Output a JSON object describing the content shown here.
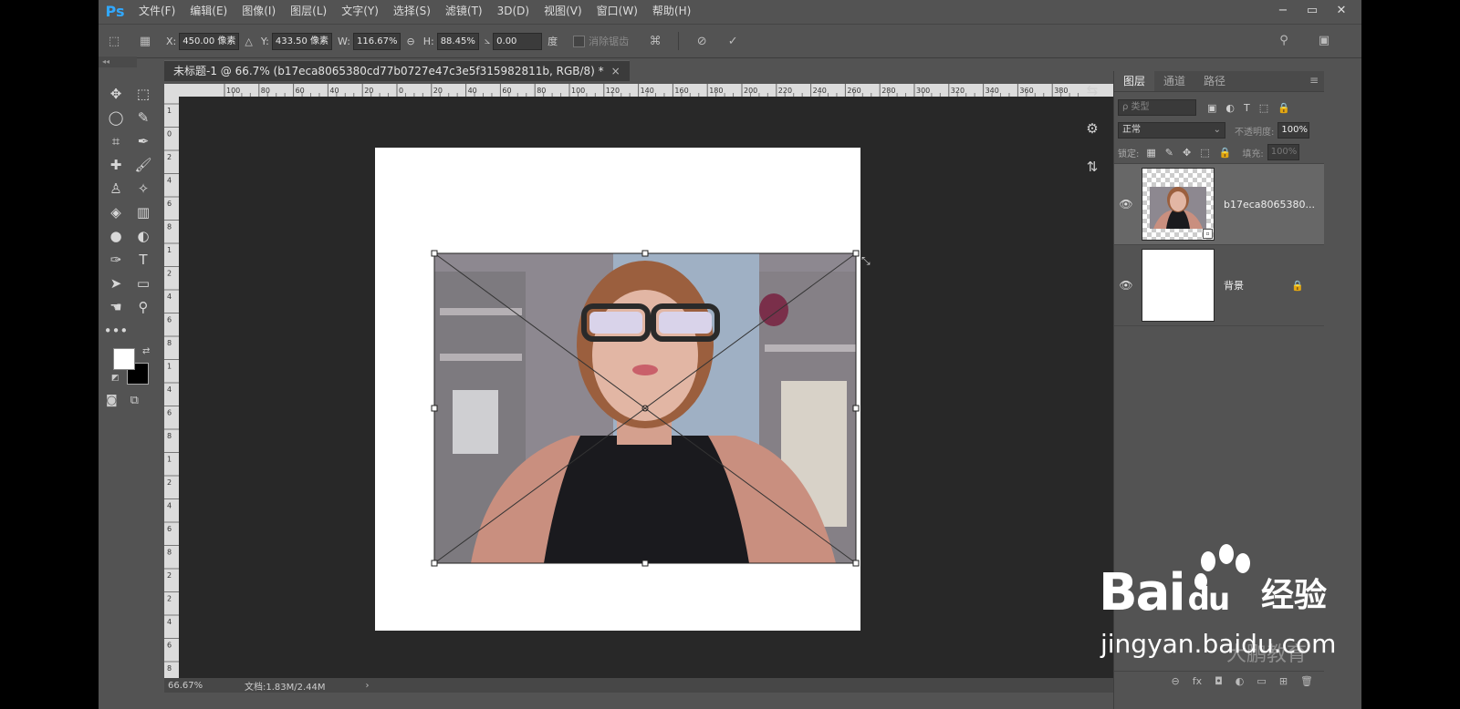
{
  "app": {
    "logo": "Ps",
    "menu": [
      "文件(F)",
      "编辑(E)",
      "图像(I)",
      "图层(L)",
      "文字(Y)",
      "选择(S)",
      "滤镜(T)",
      "3D(D)",
      "视图(V)",
      "窗口(W)",
      "帮助(H)"
    ],
    "window_controls": [
      "−",
      "▭",
      "✕"
    ]
  },
  "options_bar": {
    "x_label": "X:",
    "x_value": "450.00 像素",
    "y_label": "Y:",
    "y_value": "433.50 像素",
    "w_label": "W:",
    "w_value": "116.67%",
    "h_label": "H:",
    "h_value": "88.45%",
    "angle_value": "0.00",
    "angle_unit": "度",
    "antialias_label": "消除锯齿"
  },
  "toolbox": {
    "collapse": "◂◂",
    "tools": [
      "move-tool",
      "marquee-tool",
      "lasso-tool",
      "quick-selection-tool",
      "crop-tool",
      "eyedropper-tool",
      "healing-brush-tool",
      "brush-tool",
      "clone-stamp-tool",
      "history-brush-tool",
      "eraser-tool",
      "gradient-tool",
      "blur-tool",
      "dodge-tool",
      "pen-tool",
      "type-tool",
      "path-selection-tool",
      "rectangle-tool",
      "hand-tool",
      "zoom-tool",
      "more-tools",
      ""
    ],
    "glyphs": [
      "✥",
      "⬚",
      "◯",
      "✎",
      "⌗",
      "✒",
      "✚",
      "🖌",
      "♙",
      "✧",
      "◈",
      "▥",
      "●",
      "◐",
      "✑",
      "T",
      "➤",
      "▭",
      "☚",
      "⚲",
      "•••",
      ""
    ]
  },
  "document": {
    "tab_title": "未标题-1 @ 66.7% (b17eca8065380cd77b0727e47c3e5f315982811b, RGB/8) *",
    "tab_close": "×",
    "ruler_h": [
      "100",
      "80",
      "60",
      "40",
      "20",
      "0",
      "20",
      "40",
      "60",
      "80",
      "100",
      "120",
      "140",
      "160",
      "180",
      "200",
      "220",
      "240",
      "260",
      "280",
      "300",
      "320",
      "340",
      "360",
      "380"
    ],
    "ruler_v": [
      "1",
      "0",
      "2",
      "4",
      "6",
      "8",
      "1",
      "2",
      "4",
      "6",
      "8",
      "1",
      "4",
      "6",
      "8",
      "1",
      "2",
      "4",
      "6",
      "8",
      "2",
      "2",
      "4",
      "6",
      "8"
    ]
  },
  "status": {
    "zoom": "66.67%",
    "doc_info": "文档:1.83M/2.44M",
    "arrow": "›"
  },
  "layers_panel": {
    "tabs": [
      "图层",
      "通道",
      "路径"
    ],
    "menu_icon": "≡",
    "filter_placeholder": "ρ 类型",
    "filter_icons": [
      "▣",
      "◐",
      "T",
      "⬚",
      "🔒"
    ],
    "blend_mode": "正常",
    "opacity_label": "不透明度:",
    "opacity_value": "100%",
    "lock_label": "锁定:",
    "lock_icons": [
      "▦",
      "✎",
      "✥",
      "⬚",
      "🔒"
    ],
    "fill_label": "填充:",
    "fill_value": "100%",
    "layers": [
      {
        "name": "b17eca8065380...",
        "visible": "👁",
        "selected": true
      },
      {
        "name": "背景",
        "visible": "👁",
        "locked": "🔒"
      }
    ],
    "footer_icons": [
      "⊖",
      "fx",
      "◘",
      "◐",
      "▭",
      "⊞",
      "🗑"
    ]
  },
  "side_icons": [
    "⇆",
    "⚙",
    "⇅"
  ],
  "watermark": {
    "brand": "Bai",
    "brand_suffix": "du",
    "cn": "经验",
    "url": "jingyan.baidu.com",
    "sub": "大鹏教育"
  }
}
